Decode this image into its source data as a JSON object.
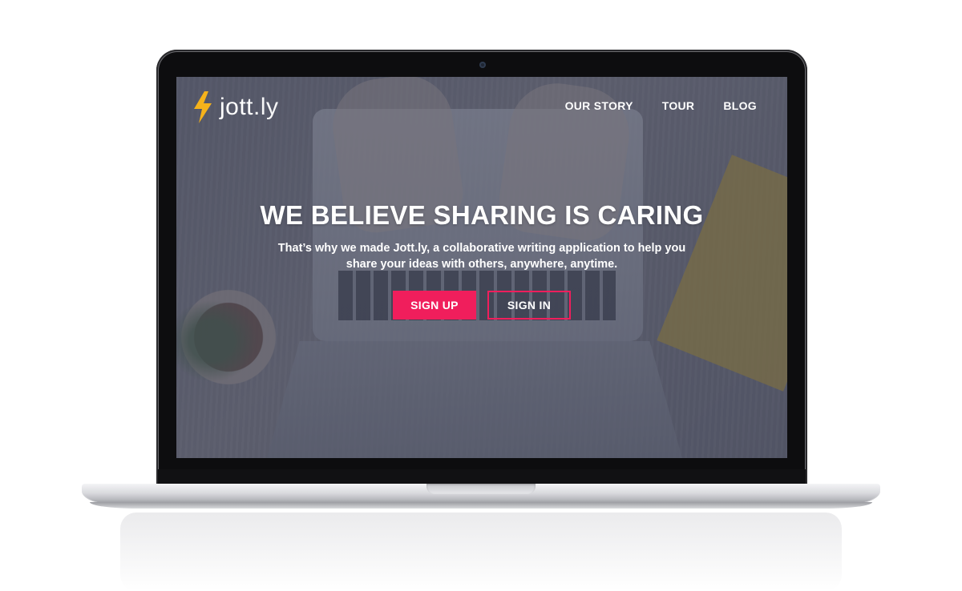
{
  "brand": {
    "logo_main": "jott",
    "logo_suffix": ".ly",
    "accent_color": "#f01e5c",
    "bolt_color": "#f5b21b",
    "logo_icon": "lightning-bolt-icon"
  },
  "nav": {
    "items": [
      {
        "label": "OUR STORY"
      },
      {
        "label": "TOUR"
      },
      {
        "label": "BLOG"
      }
    ]
  },
  "hero": {
    "headline": "WE BELIEVE SHARING IS CARING",
    "subheadline": "That’s why we made Jott.ly, a collaborative writing application to help you share your ideas with others, anywhere, anytime.",
    "sign_up_label": "SIGN UP",
    "sign_in_label": "SIGN IN"
  }
}
